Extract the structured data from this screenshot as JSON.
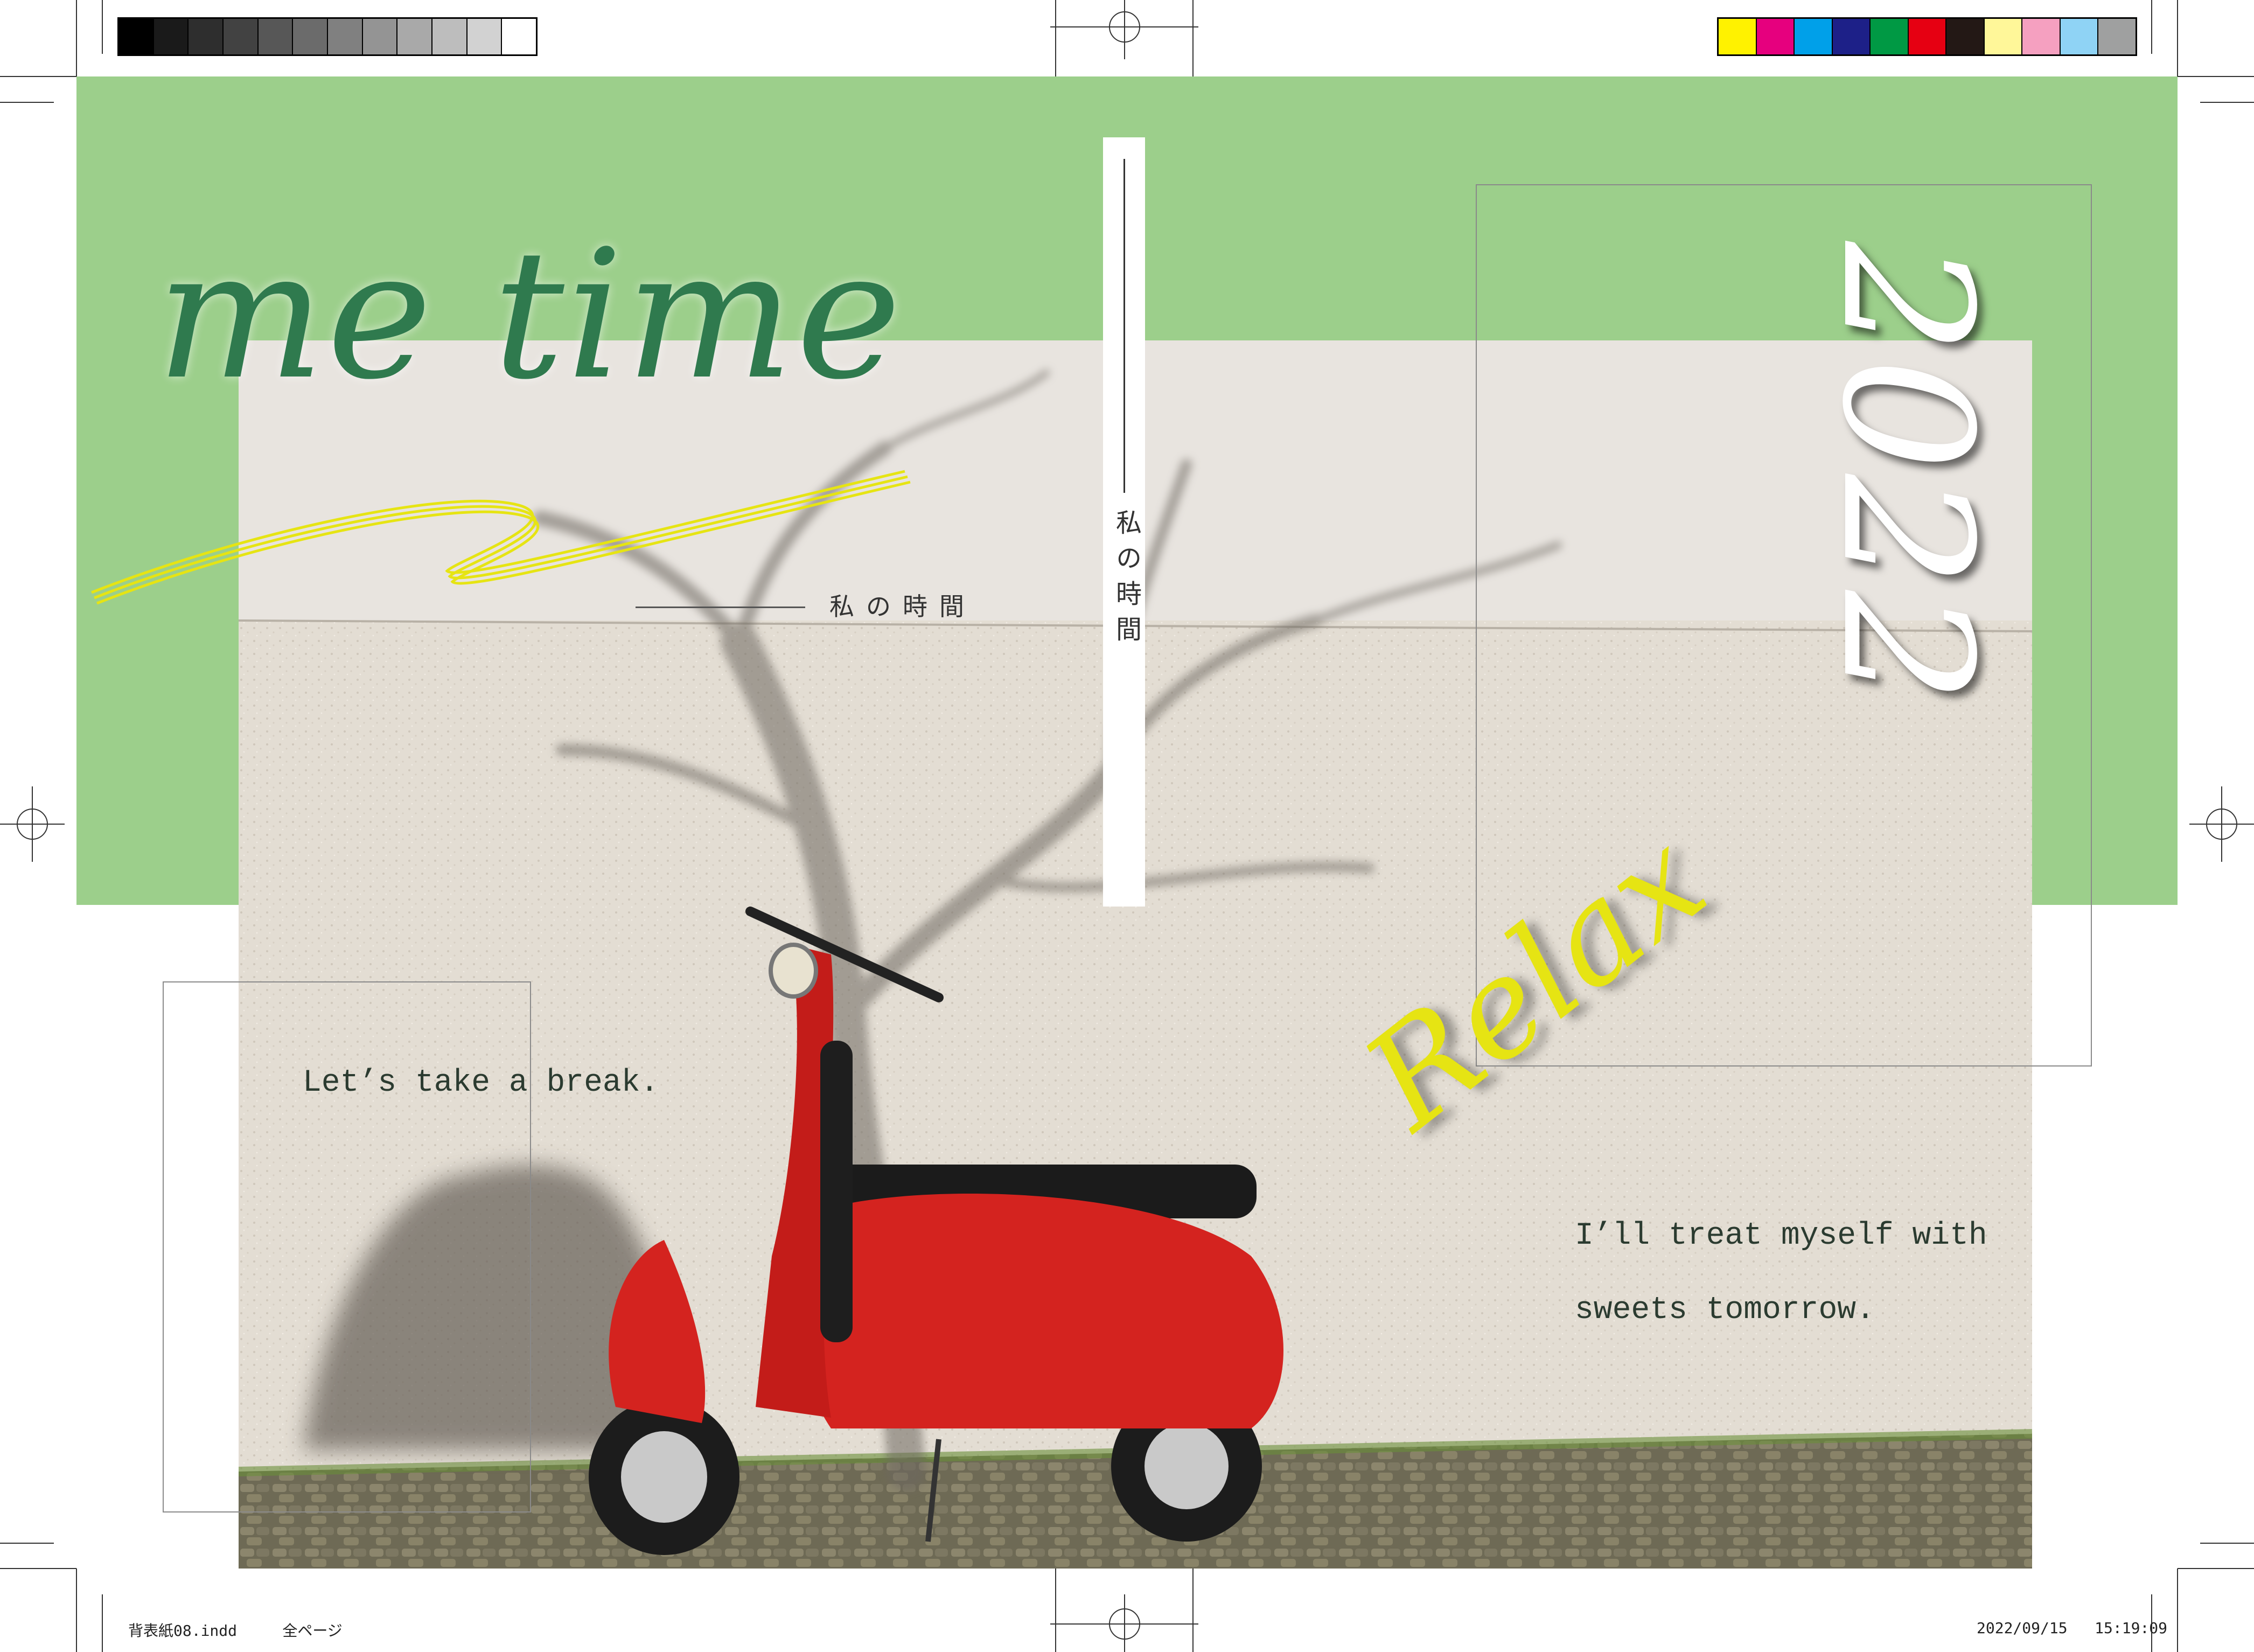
{
  "cover": {
    "title": "me time",
    "subtitle": "私の時間",
    "spine_text": "私の時間",
    "year": "2022",
    "relax": "Relax",
    "tagline_left": "Let’s take a break.",
    "tagline_right_1": "I’ll treat myself with",
    "tagline_right_2": "sweets tomorrow."
  },
  "slug": {
    "file": "背表紙08.indd",
    "pages": "全ページ",
    "date": "2022/09/15",
    "time": "15:19:09"
  },
  "colors": {
    "band": "#9ccf8b",
    "title": "#2f7a4e",
    "relax": "#e6e413",
    "scooter": "#d4231f"
  },
  "gray_swatches": [
    "#000000",
    "#1a1a1a",
    "#2e2e2e",
    "#424242",
    "#575757",
    "#6b6b6b",
    "#808080",
    "#949494",
    "#a9a9a9",
    "#bdbdbd",
    "#d2d2d2",
    "#ffffff"
  ],
  "color_swatches": [
    "#fff200",
    "#e6007e",
    "#00a0e9",
    "#1d2088",
    "#009944",
    "#e60012",
    "#231815",
    "#fff799",
    "#f5a0c0",
    "#8fd3f5",
    "#9fa0a0"
  ]
}
